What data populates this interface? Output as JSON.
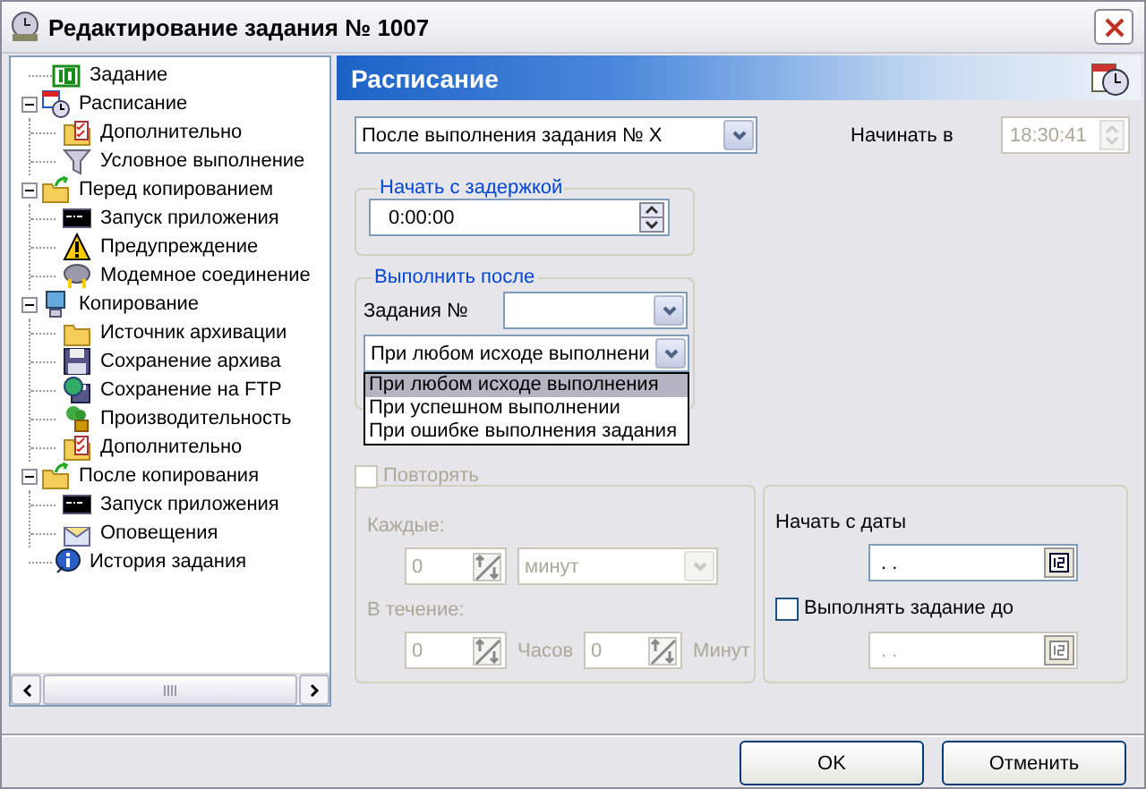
{
  "window": {
    "title": "Редактирование задания № 1007"
  },
  "tree": [
    {
      "label": "Задание",
      "kind": "id"
    },
    {
      "label": "Расписание",
      "kind": "schedule",
      "expanded": true,
      "children": [
        {
          "label": "Дополнительно",
          "kind": "extras"
        },
        {
          "label": "Условное выполнение",
          "kind": "filter"
        }
      ]
    },
    {
      "label": "Перед копированием",
      "kind": "folder_arrow",
      "expanded": true,
      "children": [
        {
          "label": "Запуск приложения",
          "kind": "console"
        },
        {
          "label": "Предупреждение",
          "kind": "warning"
        },
        {
          "label": "Модемное соединение",
          "kind": "modem"
        }
      ]
    },
    {
      "label": "Копирование",
      "kind": "computer",
      "expanded": true,
      "children": [
        {
          "label": "Источник архивации",
          "kind": "folder"
        },
        {
          "label": "Сохранение архива",
          "kind": "floppy"
        },
        {
          "label": "Сохранение на FTP",
          "kind": "globe_floppy"
        },
        {
          "label": "Производительность",
          "kind": "performance"
        },
        {
          "label": "Дополнительно",
          "kind": "extras"
        }
      ]
    },
    {
      "label": "После копирования",
      "kind": "folder_arrow",
      "expanded": true,
      "children": [
        {
          "label": "Запуск приложения",
          "kind": "console"
        },
        {
          "label": "Оповещения",
          "kind": "envelope"
        }
      ]
    },
    {
      "label": "История задания",
      "kind": "info"
    }
  ],
  "panel": {
    "title": "Расписание"
  },
  "schedule_type": {
    "value": "После выполнения задания № X"
  },
  "start_at": {
    "label": "Начинать в",
    "value": "18:30:41",
    "disabled": true
  },
  "delay_group": {
    "title": "Начать с задержкой",
    "value": "0:00:00"
  },
  "after_group": {
    "title": "Выполнить после",
    "task_label": "Задания №",
    "outcome": {
      "value": "При любом исходе выполнени",
      "expanded": true,
      "options": [
        {
          "label": "При любом исходе выполнения",
          "selected": true
        },
        {
          "label": "При успешном выполнении",
          "selected": false
        },
        {
          "label": "При ошибке выполнения задания",
          "selected": false
        }
      ]
    }
  },
  "repeat": {
    "label": "Повторять",
    "checked": false,
    "disabled": true,
    "every_label": "Каждые:",
    "every_value": "0",
    "unit": "минут",
    "during_label": "В течение:",
    "hours_value": "0",
    "hours_label": "Часов",
    "minutes_value": "0",
    "minutes_label": "Минут"
  },
  "dates": {
    "start_label": "Начать с даты",
    "start_value": ". .",
    "until_label": "Выполнять задание до",
    "until_checked": false,
    "end_value": ". .",
    "end_disabled": true
  },
  "buttons": [
    {
      "label": "OK"
    },
    {
      "label": "Отменить"
    }
  ]
}
